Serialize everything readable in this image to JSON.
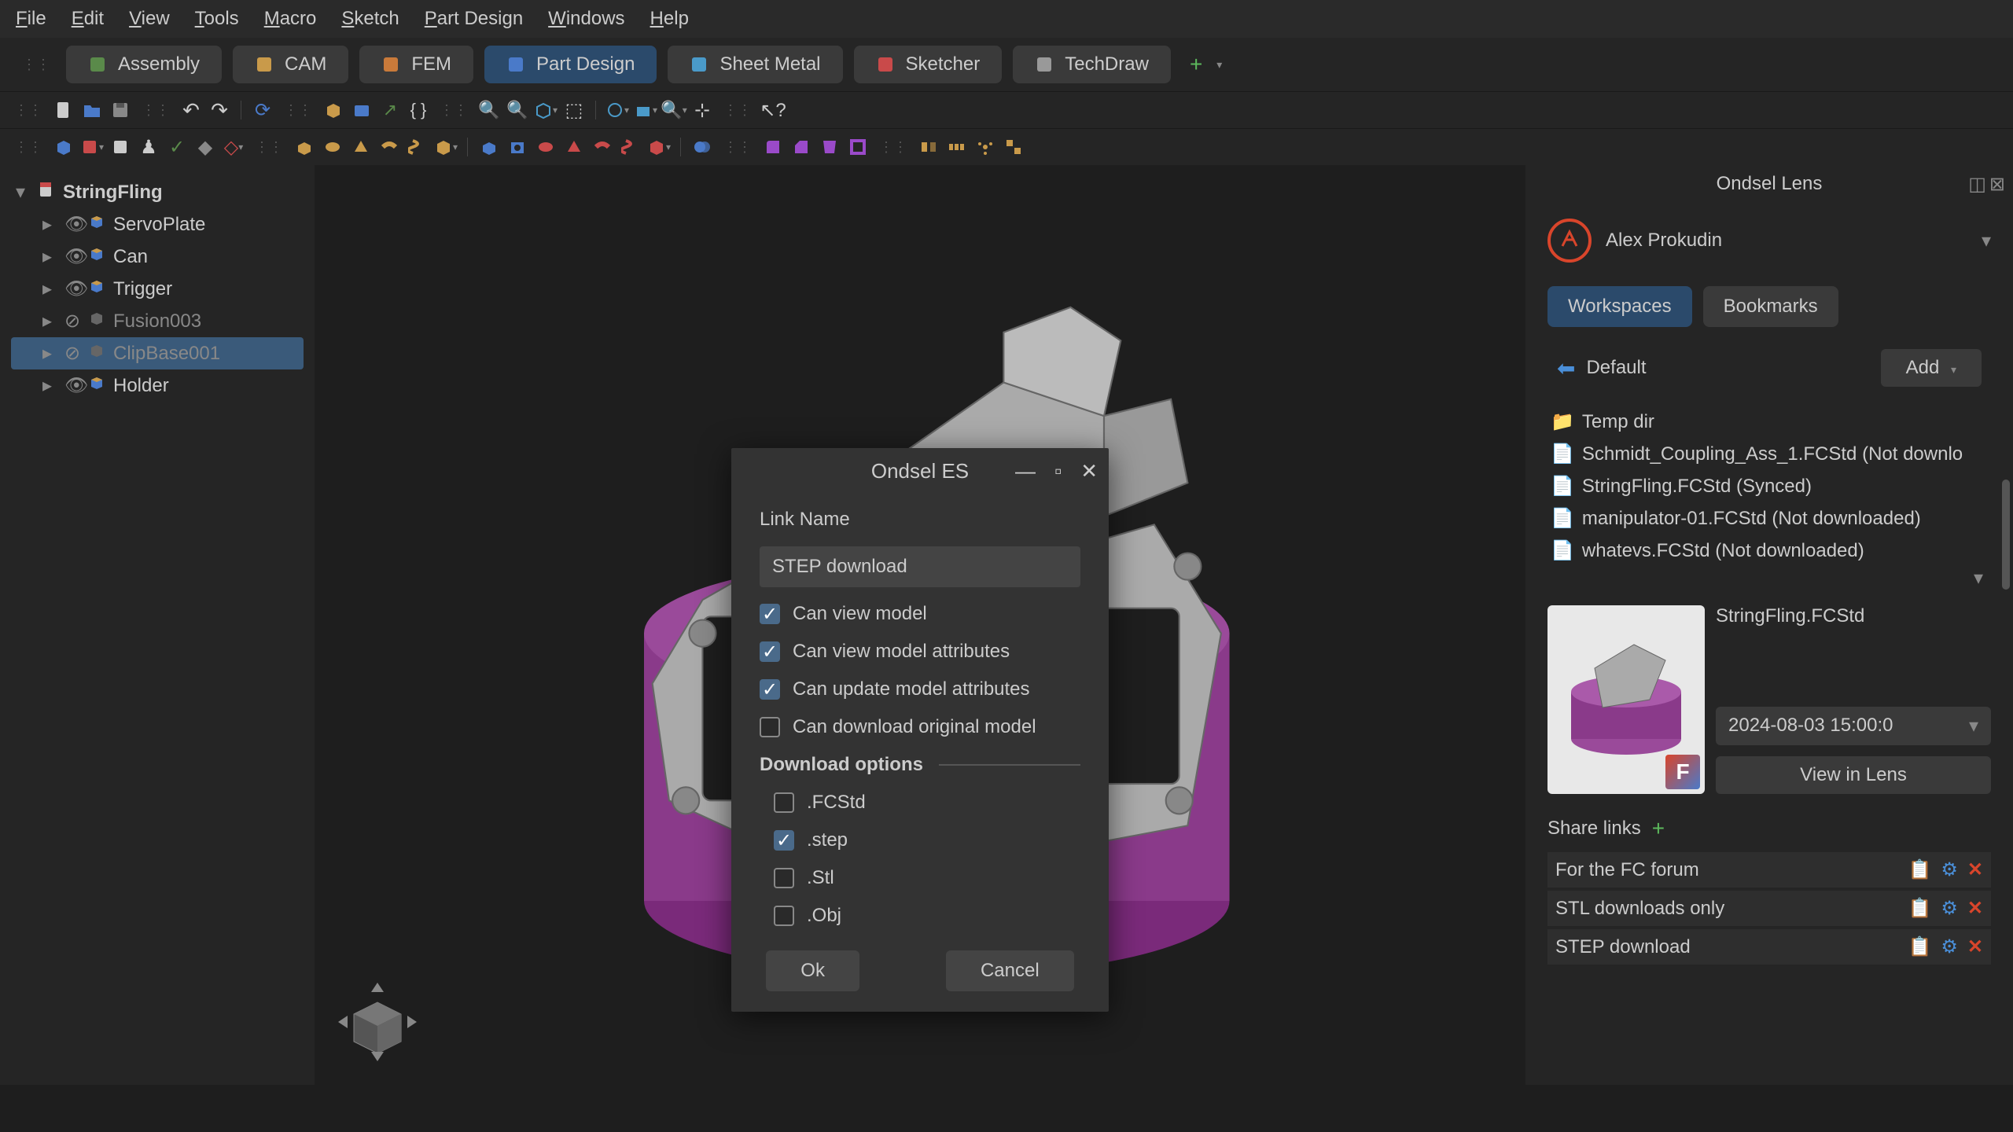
{
  "menu": [
    "File",
    "Edit",
    "View",
    "Tools",
    "Macro",
    "Sketch",
    "Part Design",
    "Windows",
    "Help"
  ],
  "workbenches": [
    {
      "label": "Assembly",
      "color": "#5a8a4a"
    },
    {
      "label": "CAM",
      "color": "#c99a4a"
    },
    {
      "label": "FEM",
      "color": "#c97a3a"
    },
    {
      "label": "Part Design",
      "color": "#4a7ac9",
      "active": true
    },
    {
      "label": "Sheet Metal",
      "color": "#4a9ac9"
    },
    {
      "label": "Sketcher",
      "color": "#c94a4a"
    },
    {
      "label": "TechDraw",
      "color": "#999"
    }
  ],
  "tree": {
    "root": "StringFling",
    "items": [
      {
        "label": "ServoPlate",
        "vis": true,
        "colored": true
      },
      {
        "label": "Can",
        "vis": true,
        "colored": true
      },
      {
        "label": "Trigger",
        "vis": true,
        "colored": true
      },
      {
        "label": "Fusion003",
        "vis": false,
        "dim": true
      },
      {
        "label": "ClipBase001",
        "vis": false,
        "dim": true,
        "selected": true
      },
      {
        "label": "Holder",
        "vis": true,
        "colored": true
      }
    ]
  },
  "dialog": {
    "title": "Ondsel ES",
    "link_name_label": "Link Name",
    "link_name_value": "STEP download",
    "perms": [
      {
        "label": "Can view model",
        "checked": true
      },
      {
        "label": "Can view model attributes",
        "checked": true
      },
      {
        "label": "Can update model attributes",
        "checked": true
      },
      {
        "label": "Can download original model",
        "checked": false
      }
    ],
    "download_header": "Download options",
    "formats": [
      {
        "label": ".FCStd",
        "checked": false
      },
      {
        "label": ".step",
        "checked": true
      },
      {
        "label": ".Stl",
        "checked": false
      },
      {
        "label": ".Obj",
        "checked": false
      }
    ],
    "ok": "Ok",
    "cancel": "Cancel"
  },
  "panel": {
    "title": "Ondsel Lens",
    "user": "Alex Prokudin",
    "tabs": {
      "workspaces": "Workspaces",
      "bookmarks": "Bookmarks"
    },
    "default": "Default",
    "add": "Add",
    "folder": "Temp dir",
    "files": [
      "Schmidt_Coupling_Ass_1.FCStd (Not downlo",
      "StringFling.FCStd (Synced)",
      "manipulator-01.FCStd (Not downloaded)",
      "whatevs.FCStd (Not downloaded)"
    ],
    "preview_name": "StringFling.FCStd",
    "preview_date": "2024-08-03 15:00:0",
    "view_in_lens": "View in Lens",
    "share_links": "Share links",
    "shares": [
      "For the FC forum",
      "STL downloads only",
      "STEP download"
    ]
  }
}
